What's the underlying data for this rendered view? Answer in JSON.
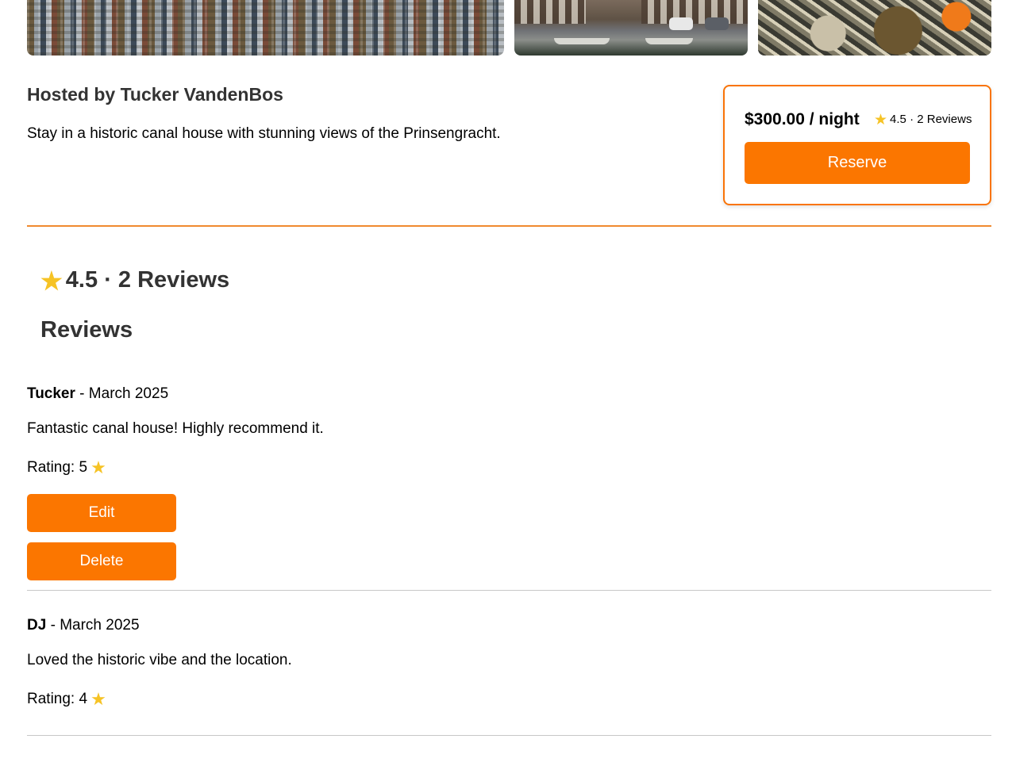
{
  "host": {
    "title": "Hosted by Tucker VandenBos",
    "description": "Stay in a historic canal house with stunning views of the Prinsengracht."
  },
  "booking": {
    "price": "$300.00 / night",
    "rating": "4.5",
    "separator": "·",
    "reviews_count": "2 Reviews",
    "reserve_label": "Reserve"
  },
  "summary": {
    "rating": "4.5",
    "separator": "·",
    "reviews_count": "2 Reviews"
  },
  "reviews_heading": "Reviews",
  "reviews": [
    {
      "author": "Tucker",
      "date": "March 2025",
      "text": "Fantastic canal house! Highly recommend it.",
      "rating_label": "Rating:",
      "rating": "5",
      "edit_label": "Edit",
      "delete_label": "Delete"
    },
    {
      "author": "DJ",
      "date": "March 2025",
      "text": "Loved the historic vibe and the location.",
      "rating_label": "Rating:",
      "rating": "4"
    }
  ],
  "icons": {
    "star": "star-icon"
  },
  "colors": {
    "accent": "#fb7600",
    "border": "#f97408",
    "star": "#f6c325",
    "heading": "#333333"
  }
}
